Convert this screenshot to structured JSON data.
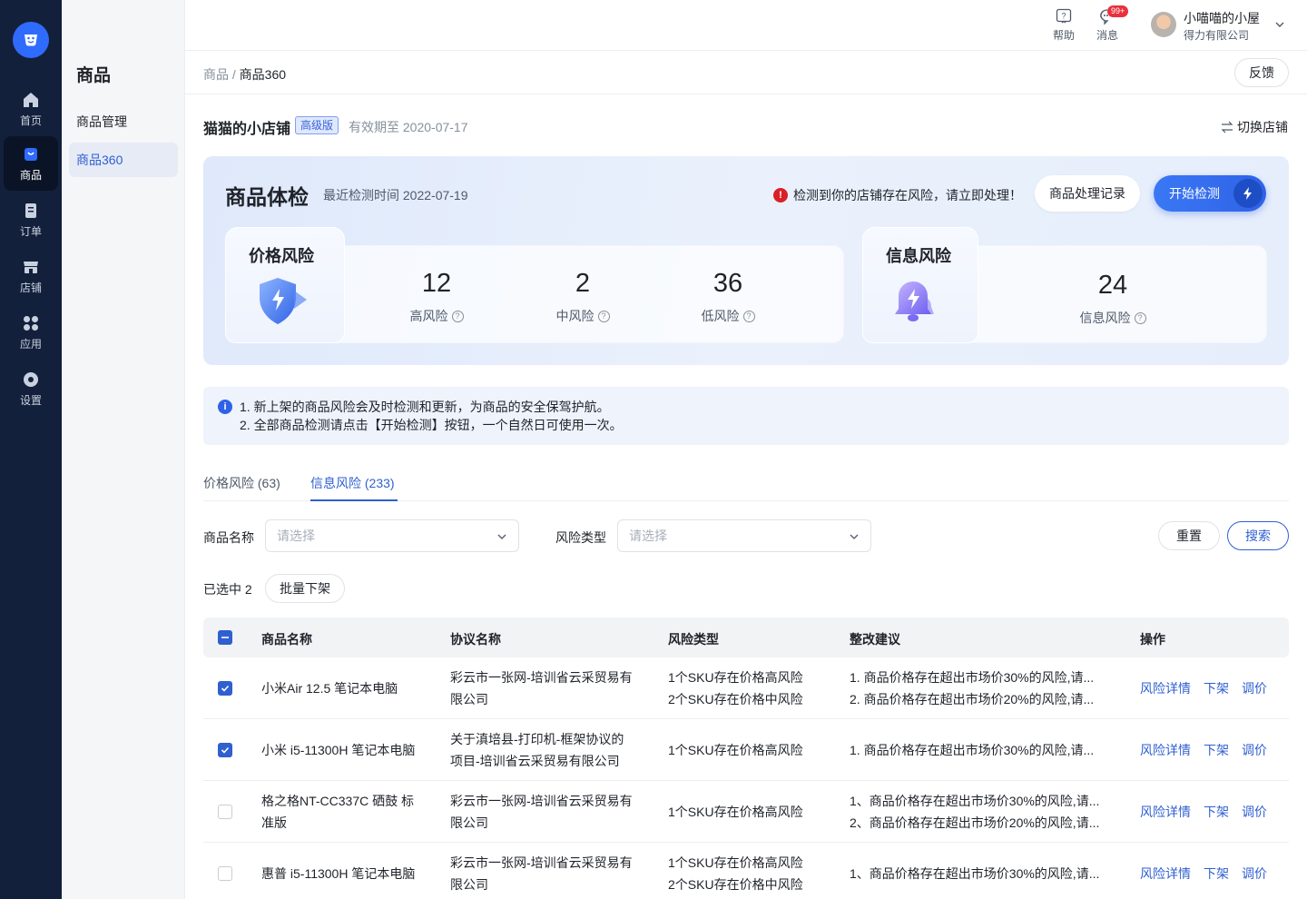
{
  "rail": {
    "items": [
      {
        "label": "首页",
        "icon": "home-icon"
      },
      {
        "label": "商品",
        "icon": "bag-icon"
      },
      {
        "label": "订单",
        "icon": "order-icon"
      },
      {
        "label": "店铺",
        "icon": "store-icon"
      },
      {
        "label": "应用",
        "icon": "apps-icon"
      },
      {
        "label": "设置",
        "icon": "gear-icon"
      }
    ]
  },
  "sidebar": {
    "title": "商品",
    "items": [
      {
        "label": "商品管理"
      },
      {
        "label": "商品360"
      }
    ]
  },
  "topbar": {
    "help": "帮助",
    "messages": "消息",
    "badge": "99+",
    "user_name": "小喵喵的小屋",
    "company": "得力有限公司"
  },
  "breadcrumb": {
    "root": "商品",
    "sep": "/",
    "current": "商品360"
  },
  "feedback": "反馈",
  "store": {
    "name": "猫猫的小店铺",
    "tier": "高级版",
    "valid": "有效期至 2020-07-17",
    "switch": "切换店铺"
  },
  "check": {
    "title": "商品体检",
    "time": "最近检测时间  2022-07-19",
    "warning": "检测到你的店铺存在风险，请立即处理！",
    "records_btn": "商品处理记录",
    "start_btn": "开始检测",
    "price": {
      "title": "价格风险",
      "high": "12",
      "high_label": "高风险",
      "mid": "2",
      "mid_label": "中风险",
      "low": "36",
      "low_label": "低风险"
    },
    "info": {
      "title": "信息风险",
      "count": "24",
      "label": "信息风险"
    }
  },
  "notice": {
    "line1": "1. 新上架的商品风险会及时检测和更新，为商品的安全保驾护航。",
    "line2": "2. 全部商品检测请点击【开始检测】按钮，一个自然日可使用一次。"
  },
  "tabs": [
    {
      "label": "价格风险 (63)"
    },
    {
      "label": "信息风险 (233)"
    }
  ],
  "filters": {
    "name_label": "商品名称",
    "name_placeholder": "请选择",
    "type_label": "风险类型",
    "type_placeholder": "请选择",
    "reset": "重置",
    "search": "搜索"
  },
  "selection": {
    "text": "已选中 2",
    "batch": "批量下架"
  },
  "table": {
    "headers": {
      "name": "商品名称",
      "agreement": "协议名称",
      "risk": "风险类型",
      "advice": "整改建议",
      "ops": "操作"
    },
    "actions": {
      "detail": "风险详情",
      "off": "下架",
      "price": "调价"
    },
    "rows": [
      {
        "checked": true,
        "name": "小米Air 12.5 笔记本电脑",
        "agreement": [
          "彩云市一张网-培训省云采贸易有",
          "限公司"
        ],
        "risk": [
          "1个SKU存在价格高风险",
          "2个SKU存在价格中风险"
        ],
        "advice": [
          "1. 商品价格存在超出市场价30%的风险,请...",
          "2. 商品价格存在超出市场价20%的风险,请..."
        ]
      },
      {
        "checked": true,
        "name": "小米 i5-11300H 笔记本电脑",
        "agreement": [
          "关于滇培县-打印机-框架协议的",
          "项目-培训省云采贸易有限公司"
        ],
        "risk": [
          "1个SKU存在价格高风险"
        ],
        "advice": [
          "1. 商品价格存在超出市场价30%的风险,请..."
        ]
      },
      {
        "checked": false,
        "name": [
          "格之格NT-CC337C 硒鼓 标",
          "准版"
        ],
        "agreement": [
          "彩云市一张网-培训省云采贸易有",
          "限公司"
        ],
        "risk": [
          "1个SKU存在价格高风险"
        ],
        "advice": [
          "1、商品价格存在超出市场价30%的风险,请...",
          "2、商品价格存在超出市场价20%的风险,请..."
        ]
      },
      {
        "checked": false,
        "name": "惠普 i5-11300H 笔记本电脑",
        "agreement": [
          "彩云市一张网-培训省云采贸易有",
          "限公司"
        ],
        "risk": [
          "1个SKU存在价格高风险",
          "2个SKU存在价格中风险"
        ],
        "advice": [
          "1、商品价格存在超出市场价30%的风险,请..."
        ]
      }
    ]
  },
  "colors": {
    "accent": "#2f5fd0",
    "rail": "#13203b",
    "danger": "#d92027"
  }
}
